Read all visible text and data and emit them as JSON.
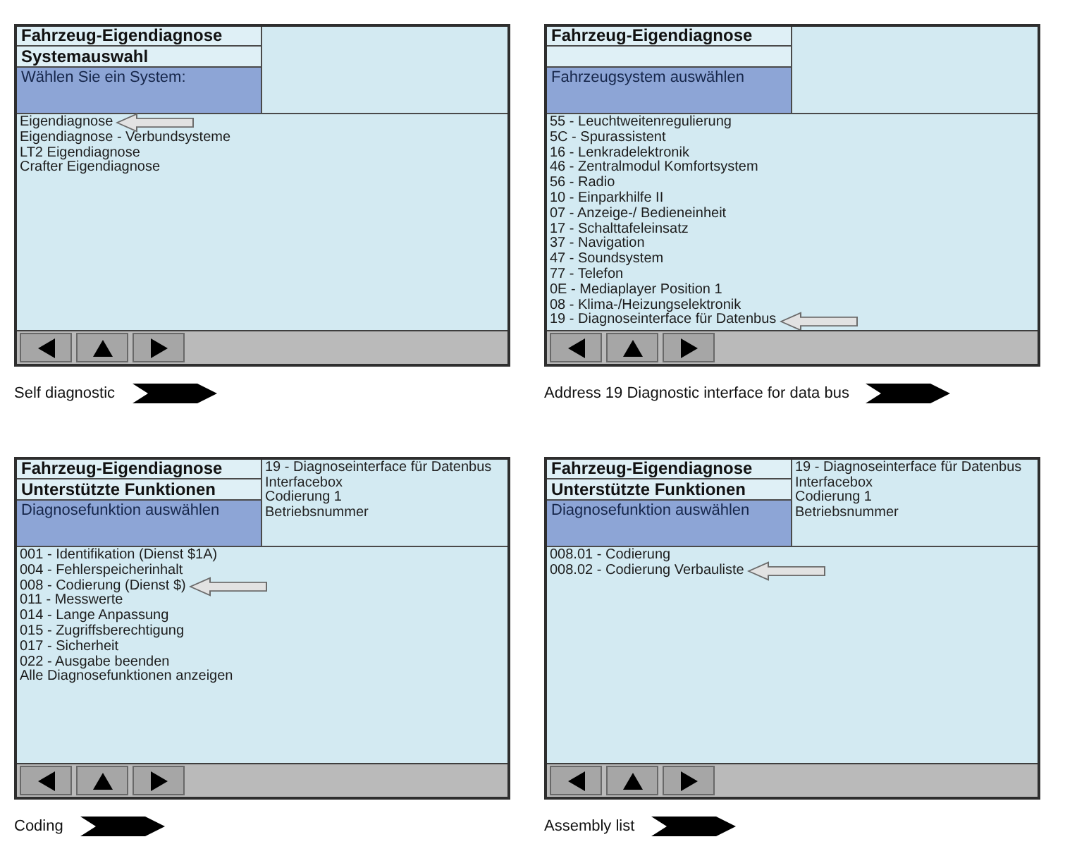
{
  "panels": [
    {
      "header": {
        "title": "Fahrzeug-Eigendiagnose",
        "subtitle": "Systemauswahl",
        "prompt": "Wählen Sie ein System:"
      },
      "items": [
        {
          "label": "Eigendiagnose",
          "selected": true
        },
        {
          "label": "Eigendiagnose - Verbundsysteme",
          "selected": false
        },
        {
          "label": "LT2 Eigendiagnose",
          "selected": false
        },
        {
          "label": "Crafter Eigendiagnose",
          "selected": false
        }
      ],
      "nav_buttons": [
        {
          "kind": "left"
        },
        {
          "kind": "up"
        },
        {
          "kind": "right"
        }
      ],
      "caption": "Self diagnostic"
    },
    {
      "header": {
        "title": "Fahrzeug-Eigendiagnose",
        "prompt": "Fahrzeugsystem auswählen"
      },
      "items": [
        {
          "label": "55 - Leuchtweitenregulierung",
          "selected": false
        },
        {
          "label": "5C - Spurassistent",
          "selected": false
        },
        {
          "label": "16 - Lenkradelektronik",
          "selected": false
        },
        {
          "label": "46 - Zentralmodul Komfortsystem",
          "selected": false
        },
        {
          "label": "56 - Radio",
          "selected": false
        },
        {
          "label": "10 - Einparkhilfe II",
          "selected": false
        },
        {
          "label": "07 - Anzeige-/ Bedieneinheit",
          "selected": false
        },
        {
          "label": "17 - Schalttafeleinsatz",
          "selected": false
        },
        {
          "label": "37 - Navigation",
          "selected": false
        },
        {
          "label": "47 - Soundsystem",
          "selected": false
        },
        {
          "label": "77 - Telefon",
          "selected": false
        },
        {
          "label": "0E - Mediaplayer Position 1",
          "selected": false
        },
        {
          "label": "08 - Klima-/Heizungselektronik",
          "selected": false
        },
        {
          "label": "19 - Diagnoseinterface für Datenbus",
          "selected": true
        }
      ],
      "nav_buttons": [
        {
          "kind": "left"
        },
        {
          "kind": "up"
        },
        {
          "kind": "right"
        }
      ],
      "caption": "Address 19 Diagnostic interface for data bus"
    },
    {
      "header": {
        "title": "Fahrzeug-Eigendiagnose",
        "subtitle": "Unterstützte Funktionen",
        "prompt": "Diagnosefunktion auswählen"
      },
      "info": [
        "19 - Diagnoseinterface für Datenbus",
        "Interfacebox",
        "Codierung 1",
        "Betriebsnummer"
      ],
      "items": [
        {
          "label": "001 - Identifikation (Dienst $1A)",
          "selected": false
        },
        {
          "label": "004 - Fehlerspeicherinhalt",
          "selected": false
        },
        {
          "label": "008 - Codierung (Dienst $)",
          "selected": true
        },
        {
          "label": "011 - Messwerte",
          "selected": false
        },
        {
          "label": "014 - Lange Anpassung",
          "selected": false
        },
        {
          "label": "015 - Zugriffsberechtigung",
          "selected": false
        },
        {
          "label": "017 - Sicherheit",
          "selected": false
        },
        {
          "label": "022 - Ausgabe beenden",
          "selected": false
        },
        {
          "label": "Alle Diagnosefunktionen anzeigen",
          "selected": false
        }
      ],
      "nav_buttons": [
        {
          "kind": "left"
        },
        {
          "kind": "up"
        },
        {
          "kind": "right"
        }
      ],
      "caption": "Coding"
    },
    {
      "header": {
        "title": "Fahrzeug-Eigendiagnose",
        "subtitle": "Unterstützte Funktionen",
        "prompt": "Diagnosefunktion auswählen"
      },
      "info": [
        "19 - Diagnoseinterface für Datenbus",
        "Interfacebox",
        "Codierung 1",
        "Betriebsnummer"
      ],
      "items": [
        {
          "label": "008.01 - Codierung",
          "selected": false
        },
        {
          "label": "008.02 - Codierung Verbauliste",
          "selected": true
        }
      ],
      "nav_buttons": [
        {
          "kind": "left"
        },
        {
          "kind": "up"
        },
        {
          "kind": "right"
        }
      ],
      "caption": "Assembly list"
    }
  ]
}
